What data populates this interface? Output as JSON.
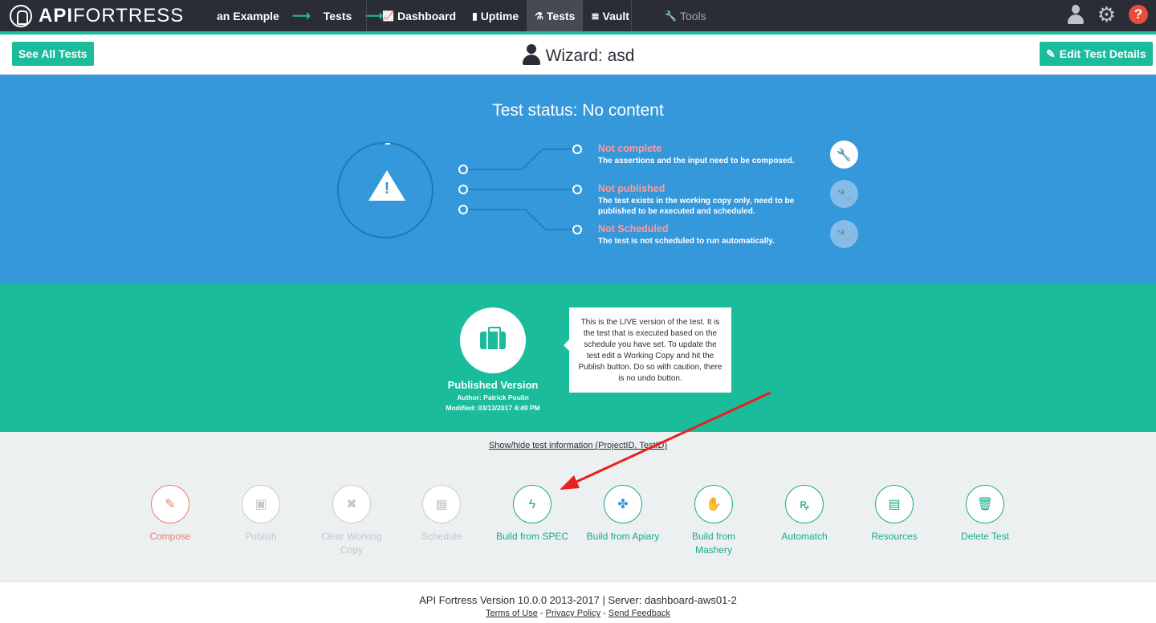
{
  "nav": {
    "logo_bold": "API",
    "logo_rest": "FORTRESS",
    "breadcrumb": [
      "an Example",
      "Tests"
    ],
    "links": [
      {
        "label": "Dashboard",
        "icon": "chart-line-icon"
      },
      {
        "label": "Uptime",
        "icon": "bar-chart-icon"
      },
      {
        "label": "Tests",
        "icon": "flask-icon"
      },
      {
        "label": "Vault",
        "icon": "database-icon"
      },
      {
        "label": "Tools",
        "icon": "wrench-icon"
      }
    ],
    "active": "Tests",
    "accent_color": "#1abc9c"
  },
  "header": {
    "see_all": "See All Tests",
    "title": "Wizard: asd",
    "edit": "Edit Test Details"
  },
  "status": {
    "title": "Test status: No content",
    "items": [
      {
        "heading": "Not complete",
        "desc": "The assertions and the input need to be composed."
      },
      {
        "heading": "Not published",
        "desc": "The test exists in the working copy only, need to be published to be executed and scheduled."
      },
      {
        "heading": "Not Scheduled",
        "desc": "The test is not scheduled to run automatically."
      }
    ],
    "bg_color": "#3498db",
    "heading_color": "#ff9a9a"
  },
  "published": {
    "name": "Published Version",
    "author": "Author: Patrick Poulin",
    "modified": "Modified: 03/13/2017 4:49 PM",
    "tooltip": "This is the LIVE version of the test. It is the test that is executed based on the schedule you have set. To update the test edit a Working Copy and hit the Publish button. Do so with caution, there is no undo button.",
    "bg_color": "#1abc9c"
  },
  "showhide": "Show/hide test information (ProjectID, TestID)",
  "actions": [
    {
      "label": "Compose",
      "icon": "pencil-icon"
    },
    {
      "label": "Publish",
      "icon": "save-icon"
    },
    {
      "label": "Clear Working Copy",
      "icon": "x-icon"
    },
    {
      "label": "Schedule",
      "icon": "calendar-icon"
    },
    {
      "label": "Build from SPEC",
      "icon": "bolt-icon"
    },
    {
      "label": "Build from Apiary",
      "icon": "apiary-icon"
    },
    {
      "label": "Build from Mashery",
      "icon": "mashery-icon"
    },
    {
      "label": "Automatch",
      "icon": "automatch-icon"
    },
    {
      "label": "Resources",
      "icon": "document-icon"
    },
    {
      "label": "Delete Test",
      "icon": "trash-icon"
    }
  ],
  "footer": {
    "version": "API Fortress Version 10.0.0 2013-2017 | Server: dashboard-aws01-2",
    "terms": "Terms of Use",
    "privacy": "Privacy Policy",
    "feedback": "Send Feedback"
  }
}
